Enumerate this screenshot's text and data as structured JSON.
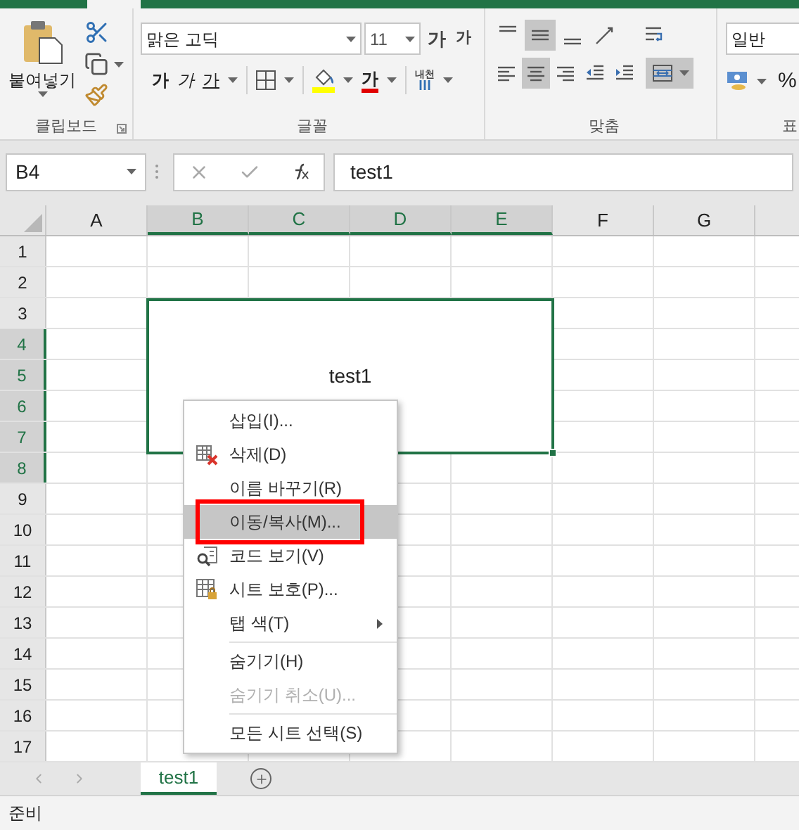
{
  "ribbon": {
    "clipboard": {
      "paste_label": "붙여넣기",
      "label": "클립보드"
    },
    "font": {
      "font_name": "맑은 고딕",
      "font_size": "11",
      "grow": "가",
      "shrink": "가",
      "bold": "가",
      "italic": "가",
      "underline": "가",
      "font_color": "가",
      "phonetic_top": "내천",
      "label": "글꼴"
    },
    "alignment": {
      "row_1": [
        {
          "kind": "top",
          "selected": false
        },
        {
          "kind": "middle",
          "selected": true
        },
        {
          "kind": "bottom",
          "selected": false
        },
        {
          "kind": "orientation",
          "selected": false
        },
        {
          "kind": "wrap",
          "selected": false
        }
      ],
      "row_2": [
        {
          "kind": "left",
          "selected": false
        },
        {
          "kind": "center",
          "selected": true
        },
        {
          "kind": "right",
          "selected": false
        },
        {
          "kind": "outdent",
          "selected": false
        },
        {
          "kind": "indent",
          "selected": false
        },
        {
          "kind": "merge",
          "selected": true
        }
      ],
      "label": "맞춤"
    },
    "number": {
      "format": "일반",
      "percent": "%",
      "label": "표"
    }
  },
  "formula_bar": {
    "name_box": "B4",
    "formula": "test1"
  },
  "columns": [
    {
      "label": "A",
      "selected": false
    },
    {
      "label": "B",
      "selected": true
    },
    {
      "label": "C",
      "selected": true
    },
    {
      "label": "D",
      "selected": true
    },
    {
      "label": "E",
      "selected": true
    },
    {
      "label": "F",
      "selected": false
    },
    {
      "label": "G",
      "selected": false
    }
  ],
  "rows": [
    {
      "label": "1",
      "selected": false
    },
    {
      "label": "2",
      "selected": false
    },
    {
      "label": "3",
      "selected": false
    },
    {
      "label": "4",
      "selected": true
    },
    {
      "label": "5",
      "selected": true
    },
    {
      "label": "6",
      "selected": true
    },
    {
      "label": "7",
      "selected": true
    },
    {
      "label": "8",
      "selected": true
    },
    {
      "label": "9",
      "selected": false
    },
    {
      "label": "10",
      "selected": false
    },
    {
      "label": "11",
      "selected": false
    },
    {
      "label": "12",
      "selected": false
    },
    {
      "label": "13",
      "selected": false
    },
    {
      "label": "14",
      "selected": false
    },
    {
      "label": "15",
      "selected": false
    },
    {
      "label": "16",
      "selected": false
    },
    {
      "label": "17",
      "selected": false
    }
  ],
  "merged_cell": {
    "text": "test1"
  },
  "context_menu": [
    {
      "kind": "plain",
      "label": "삽입(I)...",
      "disabled": false,
      "selected": false,
      "submenu": false
    },
    {
      "kind": "delete",
      "label": "삭제(D)",
      "disabled": false,
      "selected": false,
      "submenu": false
    },
    {
      "kind": "plain",
      "label": "이름 바꾸기(R)",
      "disabled": false,
      "selected": false,
      "submenu": false
    },
    {
      "kind": "plain",
      "label": "이동/복사(M)...",
      "disabled": false,
      "selected": true,
      "submenu": false
    },
    {
      "kind": "code",
      "label": "코드 보기(V)",
      "disabled": false,
      "selected": false,
      "submenu": false
    },
    {
      "kind": "protect",
      "label": "시트 보호(P)...",
      "disabled": false,
      "selected": false,
      "submenu": false
    },
    {
      "kind": "plain",
      "label": "탭 색(T)",
      "disabled": false,
      "selected": false,
      "submenu": true
    },
    {
      "kind": "separator"
    },
    {
      "kind": "plain",
      "label": "숨기기(H)",
      "disabled": false,
      "selected": false,
      "submenu": false
    },
    {
      "kind": "plain",
      "label": "숨기기 취소(U)...",
      "disabled": true,
      "selected": false,
      "submenu": false
    },
    {
      "kind": "separator"
    },
    {
      "kind": "plain",
      "label": "모든 시트 선택(S)",
      "disabled": false,
      "selected": false,
      "submenu": false
    }
  ],
  "sheet_tabs": [
    {
      "label": "test1",
      "selected": true
    }
  ],
  "status_bar": {
    "text": "준비"
  }
}
